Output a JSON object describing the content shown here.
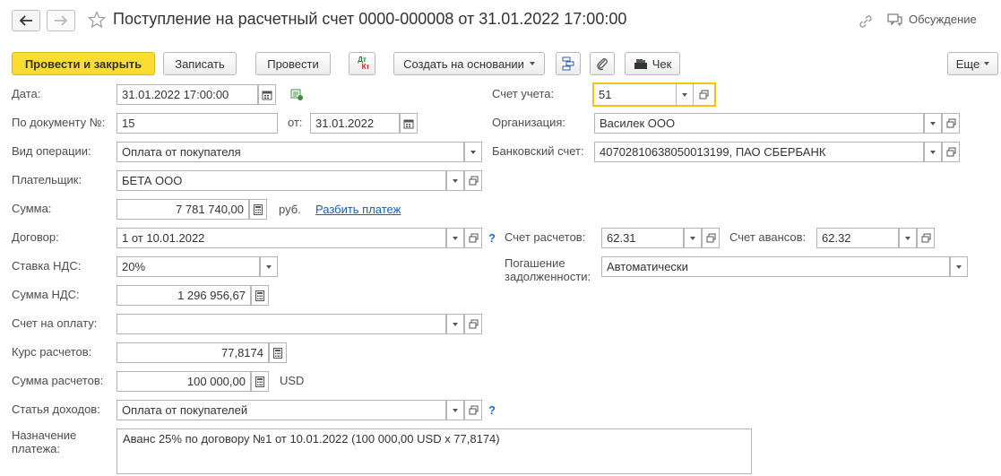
{
  "header": {
    "title": "Поступление на расчетный счет 0000-000008 от 31.01.2022 17:00:00",
    "discussion_label": "Обсуждение"
  },
  "toolbar": {
    "post_close_label": "Провести и закрыть",
    "save_label": "Записать",
    "post_label": "Провести",
    "dt_label": "Дт",
    "kt_label": "Кт",
    "create_based_label": "Создать на основании",
    "check_label": "Чек",
    "more_label": "Еще"
  },
  "form": {
    "date": {
      "label": "Дата:",
      "value": "31.01.2022 17:00:00"
    },
    "doc_number": {
      "label": "По документу №:",
      "value": "15"
    },
    "doc_date": {
      "label": "от:",
      "value": "31.01.2022"
    },
    "operation": {
      "label": "Вид операции:",
      "value": "Оплата от покупателя"
    },
    "payer": {
      "label": "Плательщик:",
      "value": "БЕТА ООО"
    },
    "amount": {
      "label": "Сумма:",
      "value": "7 781 740,00",
      "currency": "руб.",
      "split_link": "Разбить платеж"
    },
    "contract": {
      "label": "Договор:",
      "value": "1 от 10.01.2022",
      "help": "?"
    },
    "vat_rate": {
      "label": "Ставка НДС:",
      "value": "20%"
    },
    "vat_amount": {
      "label": "Сумма НДС:",
      "value": "1 296 956,67"
    },
    "invoice": {
      "label": "Счет на оплату:",
      "value": ""
    },
    "rate": {
      "label": "Курс расчетов:",
      "value": "77,8174"
    },
    "settle_amount": {
      "label": "Сумма расчетов:",
      "value": "100 000,00",
      "currency": "USD"
    },
    "income_item": {
      "label": "Статья доходов:",
      "value": "Оплата от покупателей",
      "help": "?"
    },
    "purpose": {
      "label_line1": "Назначение",
      "label_line2": "платежа:",
      "value": "Аванс 25% по договору №1 от 10.01.2022 (100 000,00 USD х 77,8174)"
    },
    "account": {
      "label": "Счет учета:",
      "value": "51"
    },
    "organization": {
      "label": "Организация:",
      "value": "Василек ООО"
    },
    "bank_account": {
      "label": "Банковский счет:",
      "value": "40702810638050013199, ПАО СБЕРБАНК"
    },
    "settle_account": {
      "label": "Счет расчетов:",
      "value": "62.31"
    },
    "advance_account": {
      "label": "Счет авансов:",
      "value": "62.32"
    },
    "debt_repay": {
      "label_line1": "Погашение",
      "label_line2": "задолженности:",
      "value": "Автоматически"
    }
  },
  "colors": {
    "primary_button": "#fbdc35",
    "focus_border": "#f1c40f",
    "link": "#1c5bb8",
    "help": "#1c6fc7"
  }
}
